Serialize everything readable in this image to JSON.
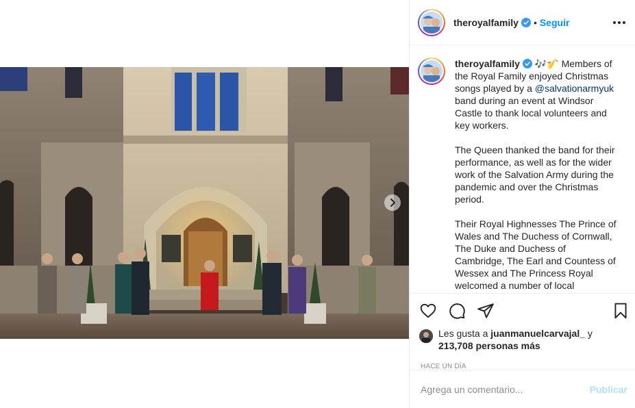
{
  "post": {
    "username": "theroyalfamily",
    "follow_label": "Seguir",
    "separator": "•",
    "caption": {
      "username": "theroyalfamily",
      "emoji": "🎶🎷",
      "paragraphs": [
        "Members of the Royal Family enjoyed Christmas songs played by a ",
        "The Queen thanked the band for their performance, as well as for the wider work of the Salvation Army during the pandemic and over the Christmas period.",
        "Their Royal Highnesses The Prince of Wales and The Duchess of Cornwall, The Duke and Duchess of Cambridge, The Earl and Countess of Wessex and The Princess Royal welcomed a number of local volunteers and key"
      ],
      "mention": "@salvationarmyuk",
      "after_mention": " band during an event at Windsor Castle to thank local volunteers and key workers."
    },
    "likes": {
      "prefix": "Les gusta a ",
      "user": "juanmanuelcarvajal_",
      "joiner": " y",
      "count": "213,708 personas más"
    },
    "time_ago": "HACE UN DÍA",
    "comment_placeholder": "Agrega un comentario...",
    "publish_label": "Publicar"
  },
  "icons": {
    "verified": "verified-badge-icon",
    "more": "more-options-icon",
    "next": "chevron-right-icon",
    "like": "heart-icon",
    "comment": "comment-icon",
    "share": "paper-plane-icon",
    "save": "bookmark-icon"
  },
  "colors": {
    "link_blue": "#0095f6",
    "mention": "#00376b",
    "muted": "#8e8e8e",
    "publish_disabled": "#b2dffc",
    "verified": "#3897f0"
  }
}
